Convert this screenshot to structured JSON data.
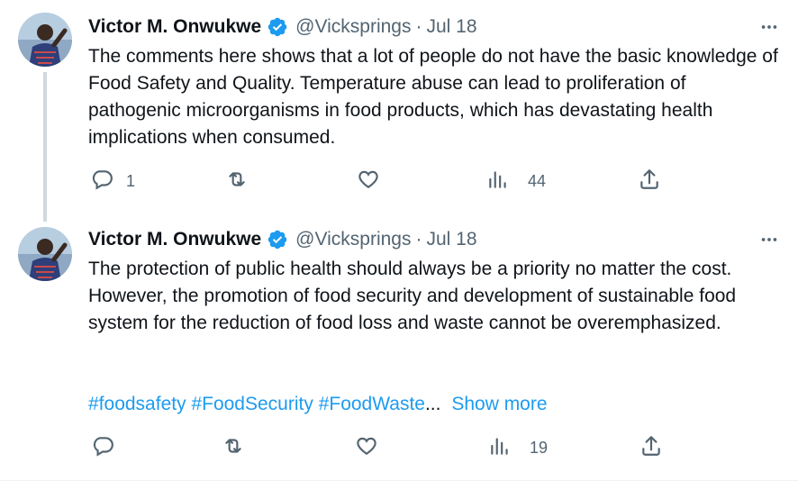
{
  "tweets": [
    {
      "author_name": "Victor M. Onwukwe",
      "handle": "@Vicksprings",
      "separator": "·",
      "date": "Jul 18",
      "text": "The comments here shows that a lot of people do not have the basic knowledge of Food Safety and Quality. Temperature abuse can lead to proliferation of pathogenic microorganisms in food products, which has devastating health implications when consumed.",
      "reply_count": "1",
      "retweet_count": "",
      "like_count": "",
      "view_count": "44"
    },
    {
      "author_name": "Victor M. Onwukwe",
      "handle": "@Vicksprings",
      "separator": "·",
      "date": "Jul 18",
      "text": "The protection of public health should always be a priority no matter the cost. However, the promotion of food security and development of sustainable food system for the reduction of food loss and waste cannot be overemphasized.",
      "hashtags": [
        "#foodsafety",
        "#FoodSecurity",
        "#FoodWaste"
      ],
      "ellipsis": "...",
      "show_more": "Show more",
      "reply_count": "",
      "retweet_count": "",
      "like_count": "",
      "view_count": "19"
    }
  ],
  "colors": {
    "accent": "#1d9bf0",
    "text": "#0f1419",
    "secondary": "#536471",
    "thread_line": "#cfd9de"
  },
  "icons": {
    "verified": "verified-badge-icon",
    "more": "more-horizontal-icon",
    "reply": "reply-icon",
    "retweet": "retweet-icon",
    "like": "heart-icon",
    "views": "views-bar-chart-icon",
    "share": "share-icon"
  }
}
